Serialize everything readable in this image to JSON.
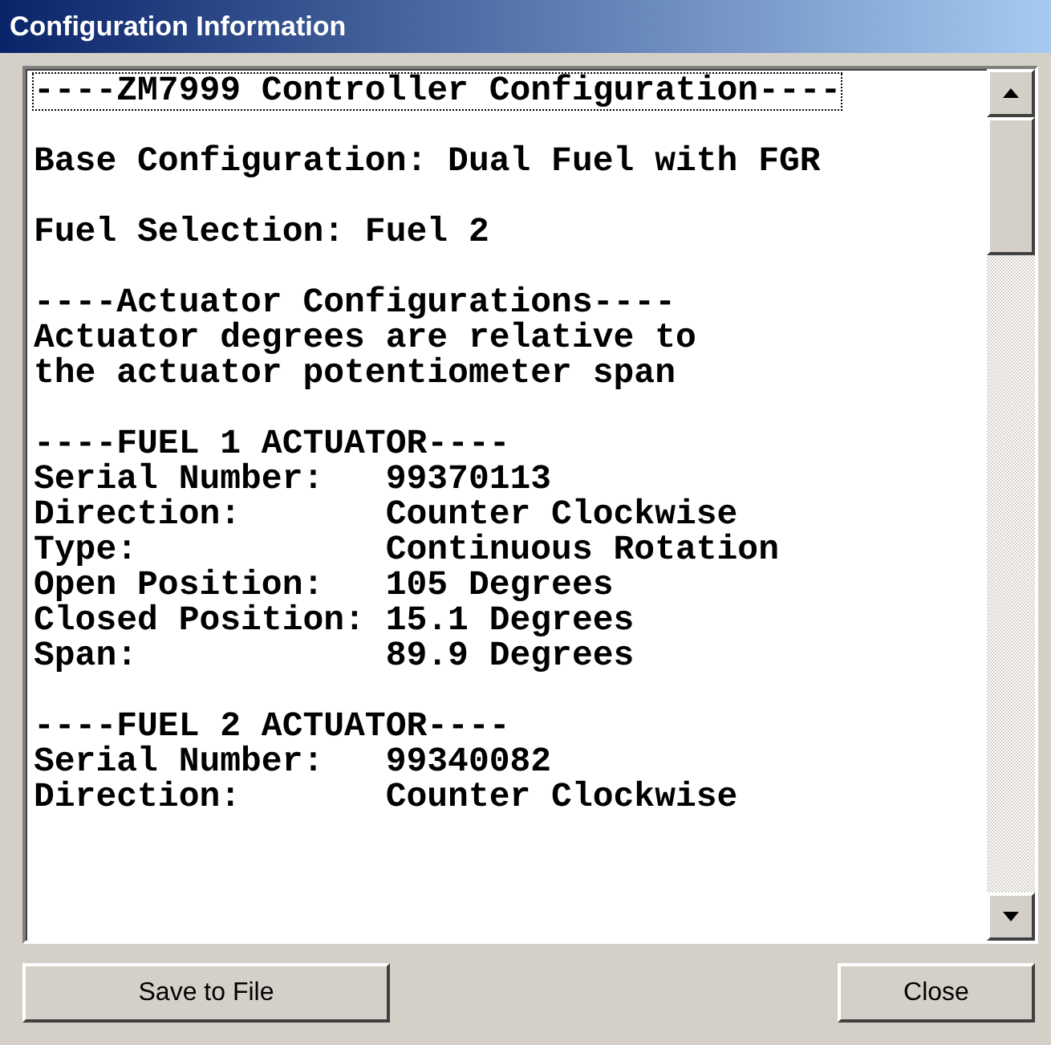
{
  "window": {
    "title": "Configuration Information"
  },
  "text_area": {
    "paragraphs": [
      {
        "lines": [
          {
            "text": "----ZM7999 Controller Configuration----",
            "focused": true
          }
        ]
      },
      {
        "lines": [
          {
            "text": "Base Configuration: Dual Fuel with FGR",
            "focused": false
          }
        ]
      },
      {
        "lines": [
          {
            "text": "Fuel Selection: Fuel 2",
            "focused": false
          }
        ]
      },
      {
        "lines": [
          {
            "text": "----Actuator Configurations----",
            "focused": false
          },
          {
            "text": "Actuator degrees are relative to",
            "focused": false
          },
          {
            "text": "the actuator potentiometer span",
            "focused": false
          }
        ]
      },
      {
        "lines": [
          {
            "text": "----FUEL 1 ACTUATOR----",
            "focused": false
          },
          {
            "text": "Serial Number:   99370113",
            "focused": false
          },
          {
            "text": "Direction:       Counter Clockwise",
            "focused": false
          },
          {
            "text": "Type:            Continuous Rotation",
            "focused": false
          },
          {
            "text": "Open Position:   105 Degrees",
            "focused": false
          },
          {
            "text": "Closed Position: 15.1 Degrees",
            "focused": false
          },
          {
            "text": "Span:            89.9 Degrees",
            "focused": false
          }
        ]
      },
      {
        "lines": [
          {
            "text": "----FUEL 2 ACTUATOR----",
            "focused": false
          },
          {
            "text": "Serial Number:   99340082",
            "focused": false
          },
          {
            "text": "Direction:       Counter Clockwise",
            "focused": false
          }
        ]
      }
    ]
  },
  "buttons": [
    {
      "label": "Save to File"
    },
    {
      "label": "Close"
    }
  ]
}
